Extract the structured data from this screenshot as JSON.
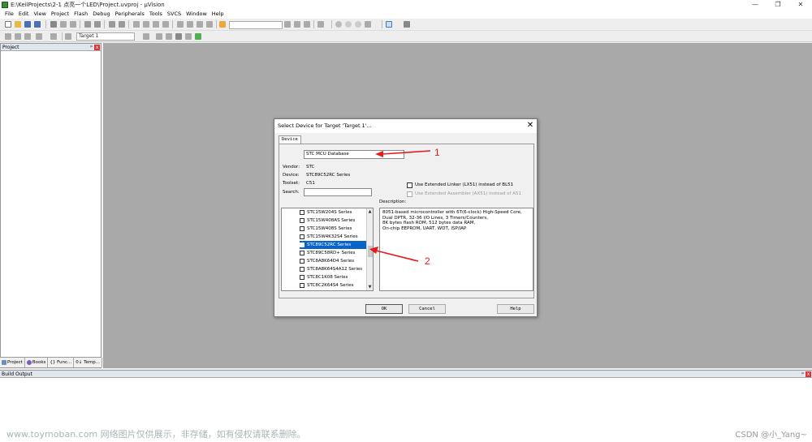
{
  "window": {
    "title": "E:\\KeilProjects\\2-1 点亮一个LED\\Project.uvproj - µVision",
    "minimize": "—",
    "maximize": "❐",
    "close": "✕"
  },
  "menu": [
    "File",
    "Edit",
    "View",
    "Project",
    "Flash",
    "Debug",
    "Peripherals",
    "Tools",
    "SVCS",
    "Window",
    "Help"
  ],
  "toolbar": {
    "target": "Target 1"
  },
  "project_panel": {
    "title": "Project",
    "pin": "ᵖ",
    "close": "x",
    "tabs": [
      {
        "label": "Project",
        "icon": "project-icon"
      },
      {
        "label": "Books",
        "icon": "books-icon"
      },
      {
        "label": "{} Func...",
        "icon": "functions-icon"
      },
      {
        "label": "0↓ Temp...",
        "icon": "templates-icon"
      }
    ]
  },
  "output": {
    "title": "Build Output",
    "pin": "ᵖ",
    "close": "x"
  },
  "dialog": {
    "title": "Select Device for Target 'Target 1'...",
    "close": "✕",
    "tab": "Device",
    "database": "STC MCU Database",
    "vendor_label": "Vendor:",
    "vendor": "STC",
    "device_label": "Device:",
    "device": "STC89C52RC Series",
    "toolset_label": "Toolset:",
    "toolset": "C51",
    "search_label": "Search:",
    "search_value": "",
    "option1": "Use Extended Linker (LX51) instead of BL51",
    "option2": "Use Extended Assembler (AX51) instead of A51",
    "description_label": "Description:",
    "description": [
      "8051-based microcontroller with 6T(6-clock) High-Speed Core,",
      "Dual DPTR, 32-36 I/O Lines, 3 Timers/Counters,",
      "8K bytes flash ROM, 512 bytes data RAM,",
      "On-chip EEPROM, UART, WDT, ISP/IAP"
    ],
    "devices": [
      "STC15W204S Series",
      "STC15W408AS Series",
      "STC15W408S Series",
      "STC15W4K32S4 Series",
      "STC89C52RC Series",
      "STC89C58RD+ Series",
      "STC8A8K64D4 Series",
      "STC8A8K64S4A12 Series",
      "STC8C1K08 Series",
      "STC8C2K64S4 Series"
    ],
    "selected_index": 4,
    "ok": "OK",
    "cancel": "Cancel",
    "help": "Help"
  },
  "annotations": {
    "arrow1": "1",
    "arrow2": "2",
    "color": "#e31b1b"
  },
  "watermark": "www.toymoban.com 网络图片仅供展示，非存储，如有侵权请联系删除。",
  "watermark2": "CSDN @小_Yang~"
}
